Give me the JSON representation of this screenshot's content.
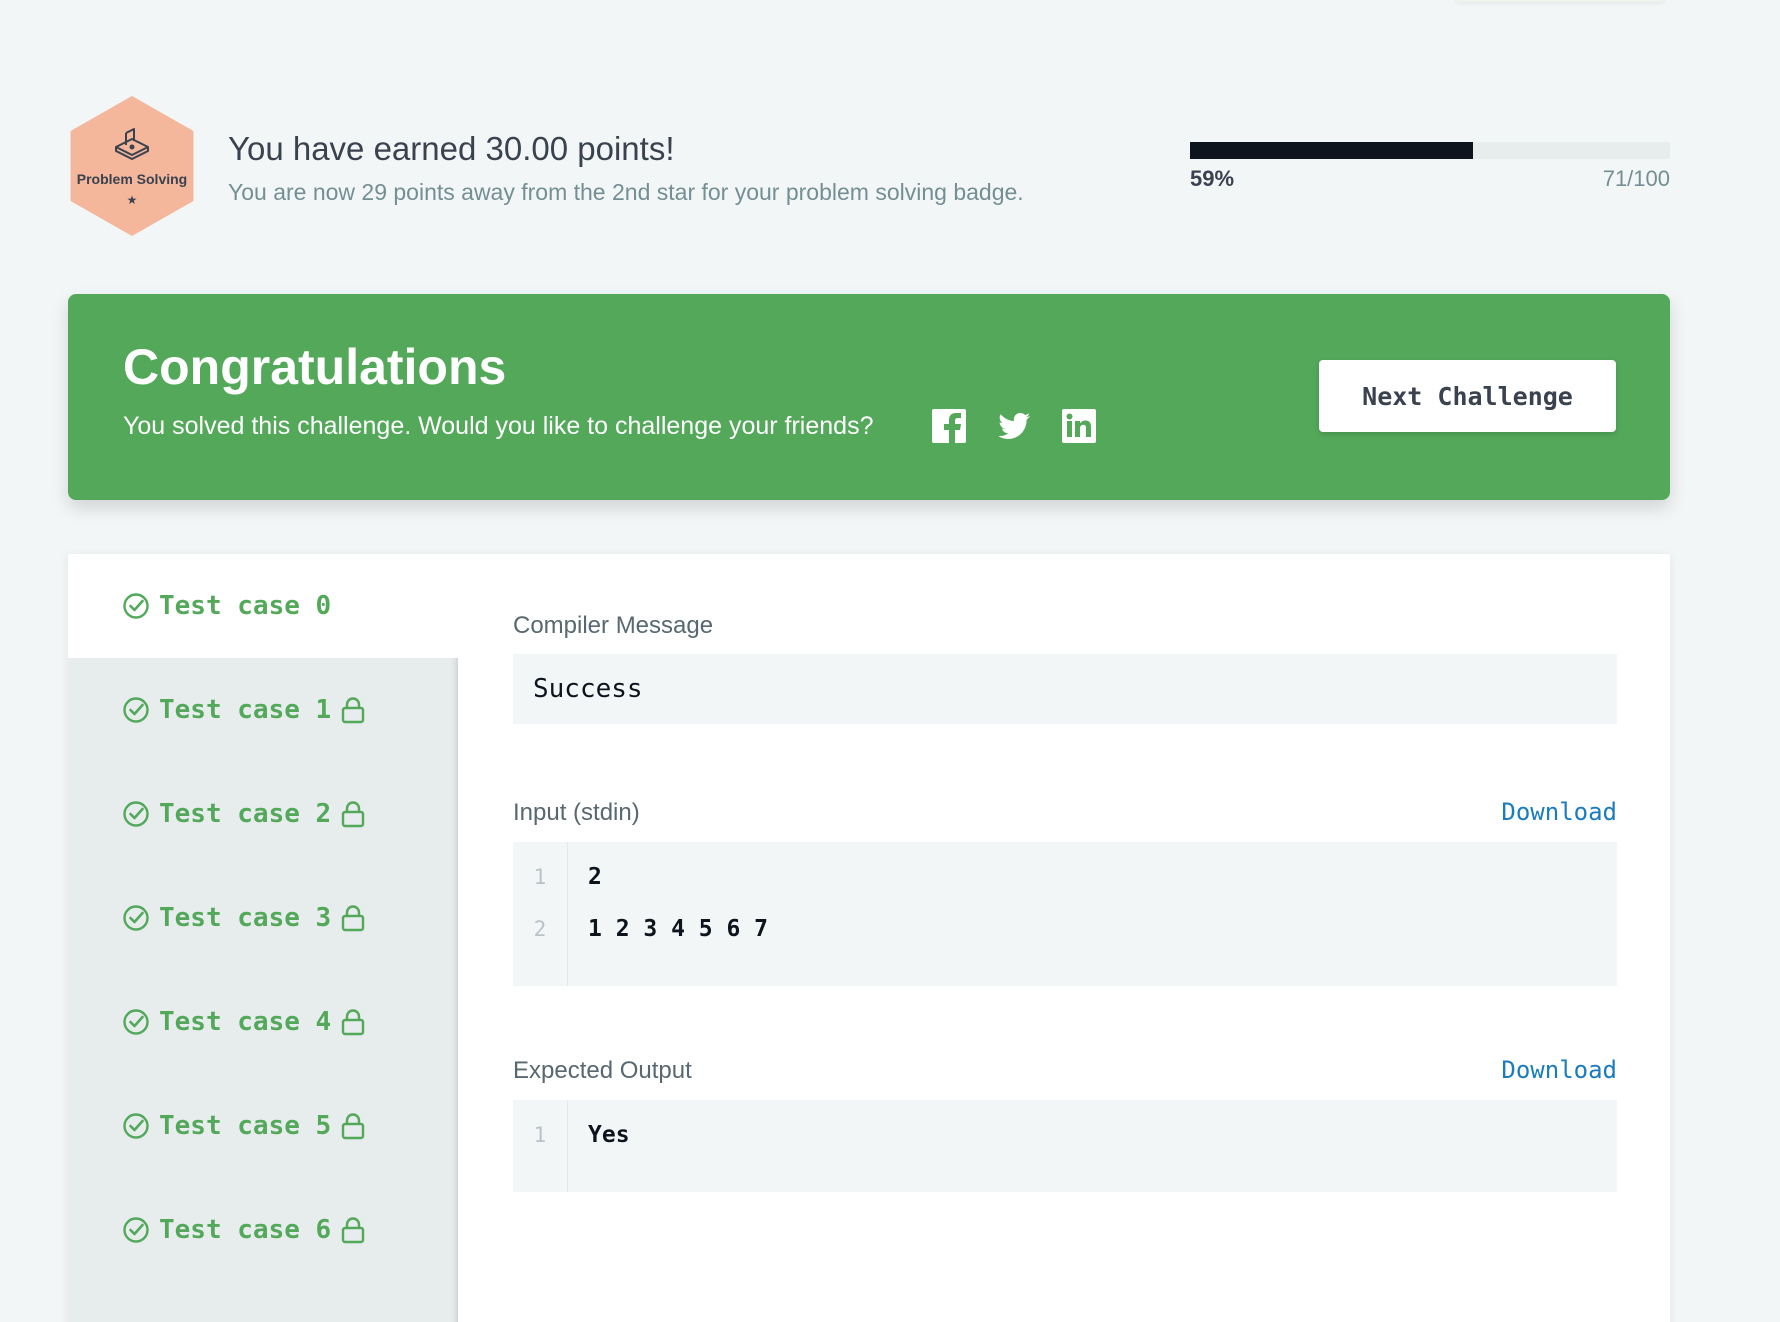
{
  "points": {
    "badge_label": "Problem Solving",
    "badge_star": "★",
    "title": "You have earned 30.00 points!",
    "subtitle": "You are now 29 points away from the 2nd star for your problem solving badge.",
    "progress_fraction": 0.59,
    "progress_percent": "59%",
    "progress_count": "71/100"
  },
  "banner": {
    "title": "Congratulations",
    "message": "You solved this challenge. Would you like to challenge your friends?",
    "social": [
      "facebook-icon",
      "twitter-icon",
      "linkedin-icon"
    ],
    "next_button": "Next Challenge",
    "color": "#53a85a"
  },
  "test_cases": [
    {
      "label": "Test case 0",
      "locked": false,
      "active": true
    },
    {
      "label": "Test case 1",
      "locked": true,
      "active": false
    },
    {
      "label": "Test case 2",
      "locked": true,
      "active": false
    },
    {
      "label": "Test case 3",
      "locked": true,
      "active": false
    },
    {
      "label": "Test case 4",
      "locked": true,
      "active": false
    },
    {
      "label": "Test case 5",
      "locked": true,
      "active": false
    },
    {
      "label": "Test case 6",
      "locked": true,
      "active": false
    }
  ],
  "details": {
    "compiler_label": "Compiler Message",
    "compiler_message": "Success",
    "input_label": "Input (stdin)",
    "input_download": "Download",
    "input_lines": [
      {
        "num": "1",
        "text": "2"
      },
      {
        "num": "2",
        "text": "1 2 3 4 5 6 7"
      }
    ],
    "output_label": "Expected Output",
    "output_download": "Download",
    "output_lines": [
      {
        "num": "1",
        "text": "Yes"
      }
    ]
  }
}
